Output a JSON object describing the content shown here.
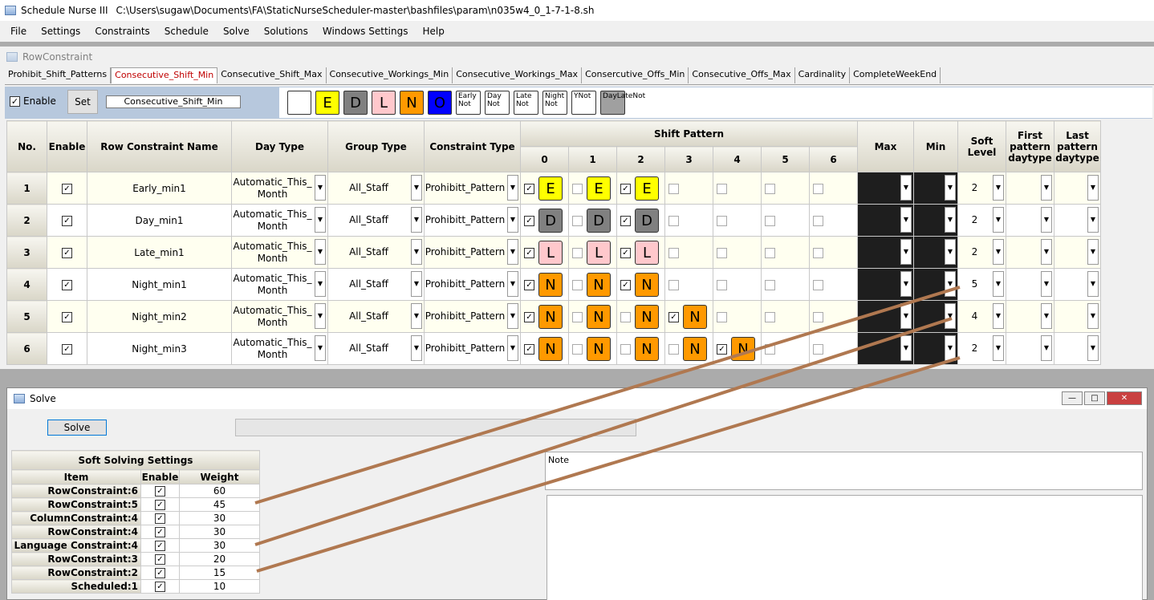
{
  "window": {
    "title": "Schedule Nurse III",
    "path": "C:\\Users\\sugaw\\Documents\\FA\\StaticNurseScheduler-master\\bashfiles\\param\\n035w4_0_1-7-1-8.sh"
  },
  "menu": [
    "File",
    "Settings",
    "Constraints",
    "Schedule",
    "Solve",
    "Solutions",
    "Windows Settings",
    "Help"
  ],
  "row_constraint": {
    "title": "RowConstraint",
    "tabs": [
      "Prohibit_Shift_Patterns",
      "Consecutive_Shift_Min",
      "Consecutive_Shift_Max",
      "Consecutive_Workings_Min",
      "Consecutive_Workings_Max",
      "Consercutive_Offs_Min",
      "Consecutive_Offs_Max",
      "Cardinality",
      "CompleteWeekEnd"
    ],
    "enable_label": "Enable",
    "set_label": "Set",
    "name_value": "Consecutive_Shift_Min",
    "palette": [
      {
        "label": "",
        "color": "#ffffff"
      },
      {
        "label": "E",
        "color": "#ffff00"
      },
      {
        "label": "D",
        "color": "#808080"
      },
      {
        "label": "L",
        "color": "#ffc8cc"
      },
      {
        "label": "N",
        "color": "#ff9900"
      },
      {
        "label": "O",
        "color": "#0000ff"
      },
      {
        "label": "Early Not",
        "color": "#ffffff"
      },
      {
        "label": "Day Not",
        "color": "#ffffff"
      },
      {
        "label": "Late Not",
        "color": "#ffffff"
      },
      {
        "label": "Night Not",
        "color": "#ffffff"
      },
      {
        "label": "YNot",
        "color": "#ffffff"
      },
      {
        "label": "DayLateNot",
        "color": "#a0a0a0"
      }
    ],
    "headers": {
      "no": "No.",
      "enable": "Enable",
      "name": "Row Constraint Name",
      "day_type": "Day Type",
      "group_type": "Group Type",
      "constraint_type": "Constraint Type",
      "shift_pattern": "Shift Pattern",
      "cols": [
        "0",
        "1",
        "2",
        "3",
        "4",
        "5",
        "6"
      ],
      "max": "Max",
      "min": "Min",
      "soft": "Soft Level",
      "first": "First pattern daytype",
      "last": "Last pattern daytype"
    },
    "rows": [
      {
        "no": "1",
        "name": "Early_min1",
        "day": "Automatic_This_ Month",
        "group": "All_Staff",
        "ctype": "Prohibitt_Pattern",
        "soft": "2",
        "pattern": [
          {
            "c": 1,
            "s": "E"
          },
          {
            "c": 0,
            "s": "E"
          },
          {
            "c": 1,
            "s": "E"
          },
          {
            "c": 0,
            "s": ""
          },
          {
            "c": 0,
            "s": ""
          },
          {
            "c": 0,
            "s": ""
          },
          {
            "c": 0,
            "s": ""
          }
        ]
      },
      {
        "no": "2",
        "name": "Day_min1",
        "day": "Automatic_This_ Month",
        "group": "All_Staff",
        "ctype": "Prohibitt_Pattern",
        "soft": "2",
        "pattern": [
          {
            "c": 1,
            "s": "D"
          },
          {
            "c": 0,
            "s": "D"
          },
          {
            "c": 1,
            "s": "D"
          },
          {
            "c": 0,
            "s": ""
          },
          {
            "c": 0,
            "s": ""
          },
          {
            "c": 0,
            "s": ""
          },
          {
            "c": 0,
            "s": ""
          }
        ]
      },
      {
        "no": "3",
        "name": "Late_min1",
        "day": "Automatic_This_ Month",
        "group": "All_Staff",
        "ctype": "Prohibitt_Pattern",
        "soft": "2",
        "pattern": [
          {
            "c": 1,
            "s": "L"
          },
          {
            "c": 0,
            "s": "L"
          },
          {
            "c": 1,
            "s": "L"
          },
          {
            "c": 0,
            "s": ""
          },
          {
            "c": 0,
            "s": ""
          },
          {
            "c": 0,
            "s": ""
          },
          {
            "c": 0,
            "s": ""
          }
        ]
      },
      {
        "no": "4",
        "name": "Night_min1",
        "day": "Automatic_This_ Month",
        "group": "All_Staff",
        "ctype": "Prohibitt_Pattern",
        "soft": "5",
        "pattern": [
          {
            "c": 1,
            "s": "N"
          },
          {
            "c": 0,
            "s": "N"
          },
          {
            "c": 1,
            "s": "N"
          },
          {
            "c": 0,
            "s": ""
          },
          {
            "c": 0,
            "s": ""
          },
          {
            "c": 0,
            "s": ""
          },
          {
            "c": 0,
            "s": ""
          }
        ]
      },
      {
        "no": "5",
        "name": "Night_min2",
        "day": "Automatic_This_ Month",
        "group": "All_Staff",
        "ctype": "Prohibitt_Pattern",
        "soft": "4",
        "pattern": [
          {
            "c": 1,
            "s": "N"
          },
          {
            "c": 0,
            "s": "N"
          },
          {
            "c": 0,
            "s": "N"
          },
          {
            "c": 1,
            "s": "N"
          },
          {
            "c": 0,
            "s": ""
          },
          {
            "c": 0,
            "s": ""
          },
          {
            "c": 0,
            "s": ""
          }
        ]
      },
      {
        "no": "6",
        "name": "Night_min3",
        "day": "Automatic_This_ Month",
        "group": "All_Staff",
        "ctype": "Prohibitt_Pattern",
        "soft": "2",
        "pattern": [
          {
            "c": 1,
            "s": "N"
          },
          {
            "c": 0,
            "s": "N"
          },
          {
            "c": 0,
            "s": "N"
          },
          {
            "c": 0,
            "s": "N"
          },
          {
            "c": 1,
            "s": "N"
          },
          {
            "c": 0,
            "s": ""
          },
          {
            "c": 0,
            "s": ""
          }
        ]
      }
    ]
  },
  "solve": {
    "title": "Solve",
    "button": "Solve",
    "table_title": "Soft Solving Settings",
    "col_item": "Item",
    "col_enable": "Enable",
    "col_weight": "Weight",
    "rows": [
      {
        "item": "RowConstraint:6",
        "weight": "60"
      },
      {
        "item": "RowConstraint:5",
        "weight": "45"
      },
      {
        "item": "ColumnConstraint:4",
        "weight": "30"
      },
      {
        "item": "RowConstraint:4",
        "weight": "30"
      },
      {
        "item": "Language Constraint:4",
        "weight": "30"
      },
      {
        "item": "RowConstraint:3",
        "weight": "20"
      },
      {
        "item": "RowConstraint:2",
        "weight": "15"
      },
      {
        "item": "Scheduled:1",
        "weight": "10"
      }
    ],
    "note_label": "Note"
  },
  "colors": {
    "annotation_line": "#b07850"
  }
}
